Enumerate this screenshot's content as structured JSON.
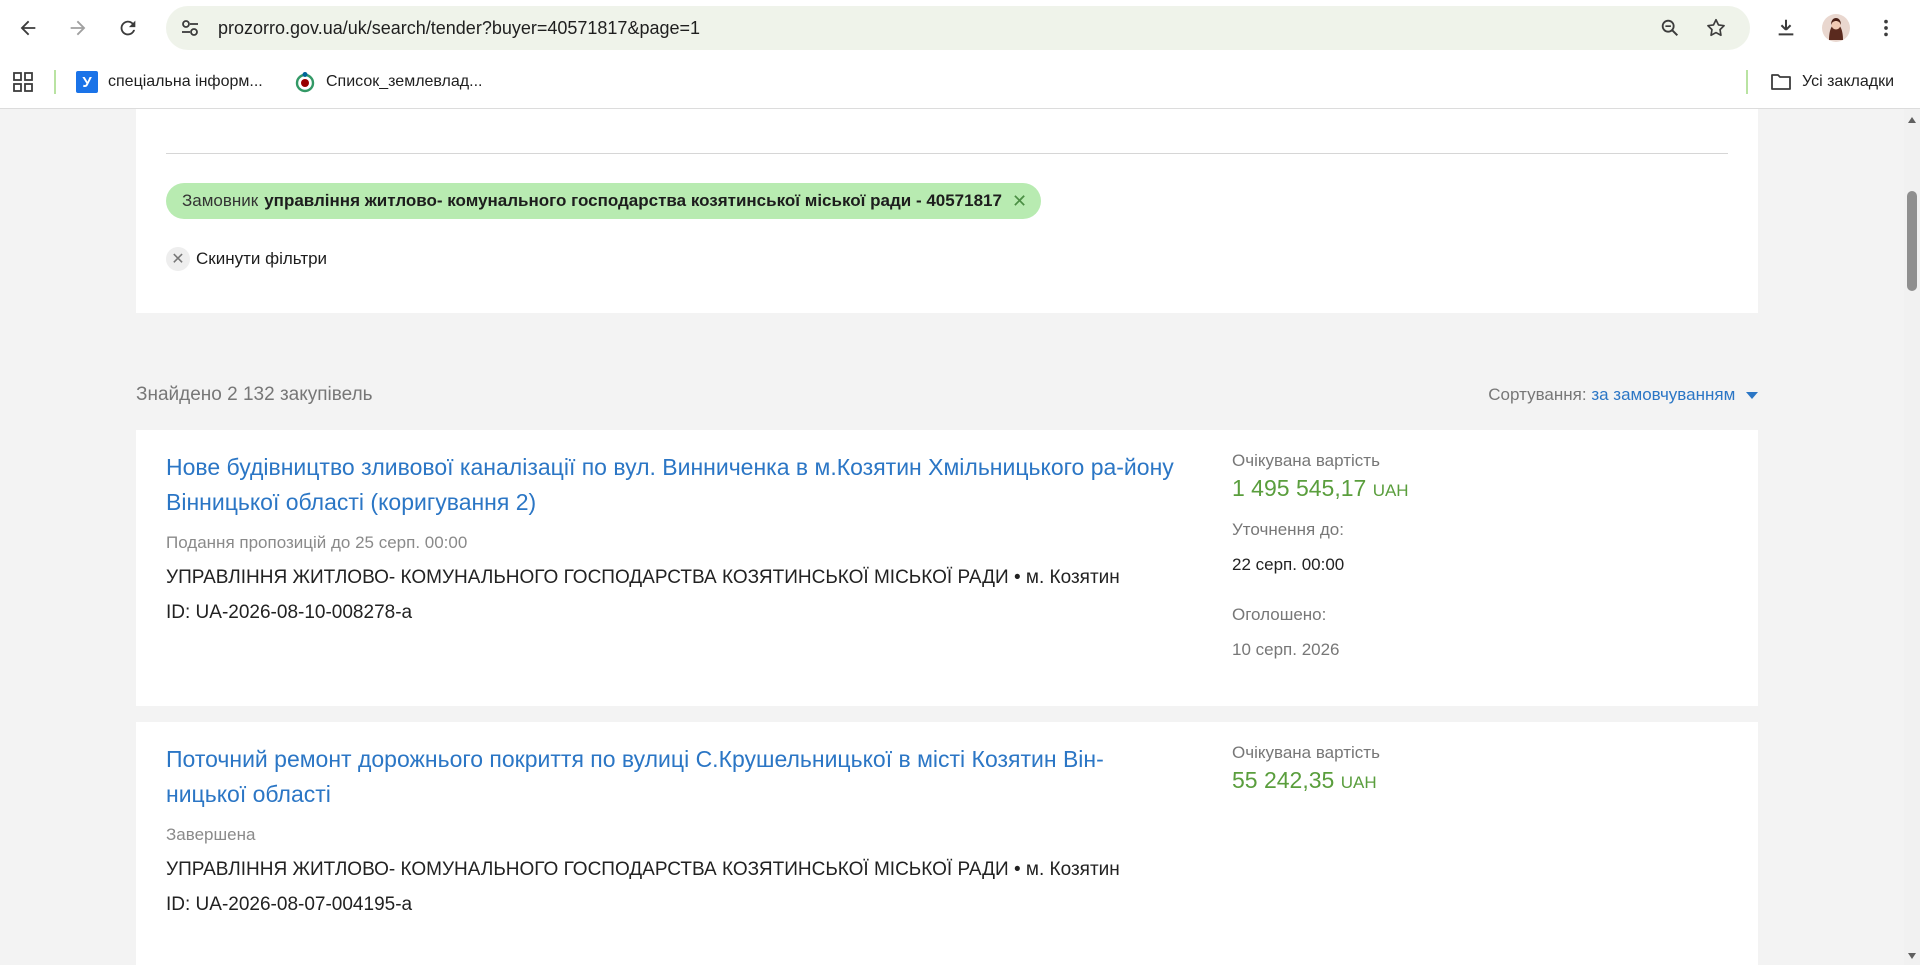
{
  "browser": {
    "url": "prozorro.gov.ua/uk/search/tender?buyer=40571817&page=1",
    "bookmarks": [
      {
        "label": "спеціальна інформ...",
        "icon_text": "У"
      },
      {
        "label": "Список_землевлад..."
      }
    ],
    "all_bookmarks_label": "Усі закладки"
  },
  "filters": {
    "chip_label": "Замовник",
    "chip_value": "управління житлово- комунального господарства козятинської міської ради - 40571817",
    "reset_label": "Скинути фільтри"
  },
  "results": {
    "found_text": "Знайдено 2 132 закупівель",
    "sort_label": "Сортування:",
    "sort_value": "за замовчуванням"
  },
  "tenders": [
    {
      "title": "Нове будівництво зливової каналізації по вул. Винниченка в м.Козятин Хмільницького ра-йону Вінницької області (коригування 2)",
      "status": "Подання пропозицій до 25 серп. 00:00",
      "buyer": "УПРАВЛІННЯ ЖИТЛОВО- КОМУНАЛЬНОГО ГОСПОДАРСТВА КОЗЯТИНСЬКОЇ МІСЬКОЇ РАДИ • м. Козятин",
      "id": "ID: UA-2026-08-10-008278-a",
      "expected_label": "Очікувана вартість",
      "amount": "1 495 545,17",
      "currency": "UAH",
      "clarify_label": "Уточнення до:",
      "clarify_date": "22 серп. 00:00",
      "announced_label": "Оголошено:",
      "announced_date": "10 серп. 2026"
    },
    {
      "title": "Поточний ремонт дорожнього покриття по вулиці С.Крушельницької в місті Козятин Він-ницької області",
      "status": "Завершена",
      "buyer": "УПРАВЛІННЯ ЖИТЛОВО- КОМУНАЛЬНОГО ГОСПОДАРСТВА КОЗЯТИНСЬКОЇ МІСЬКОЇ РАДИ • м. Козятин",
      "id": "ID: UA-2026-08-07-004195-a",
      "expected_label": "Очікувана вартість",
      "amount": "55 242,35",
      "currency": "UAH"
    }
  ],
  "colors": {
    "link": "#2b76c5",
    "amount": "#5a9e3d",
    "chip_bg": "#b8ebb1"
  }
}
